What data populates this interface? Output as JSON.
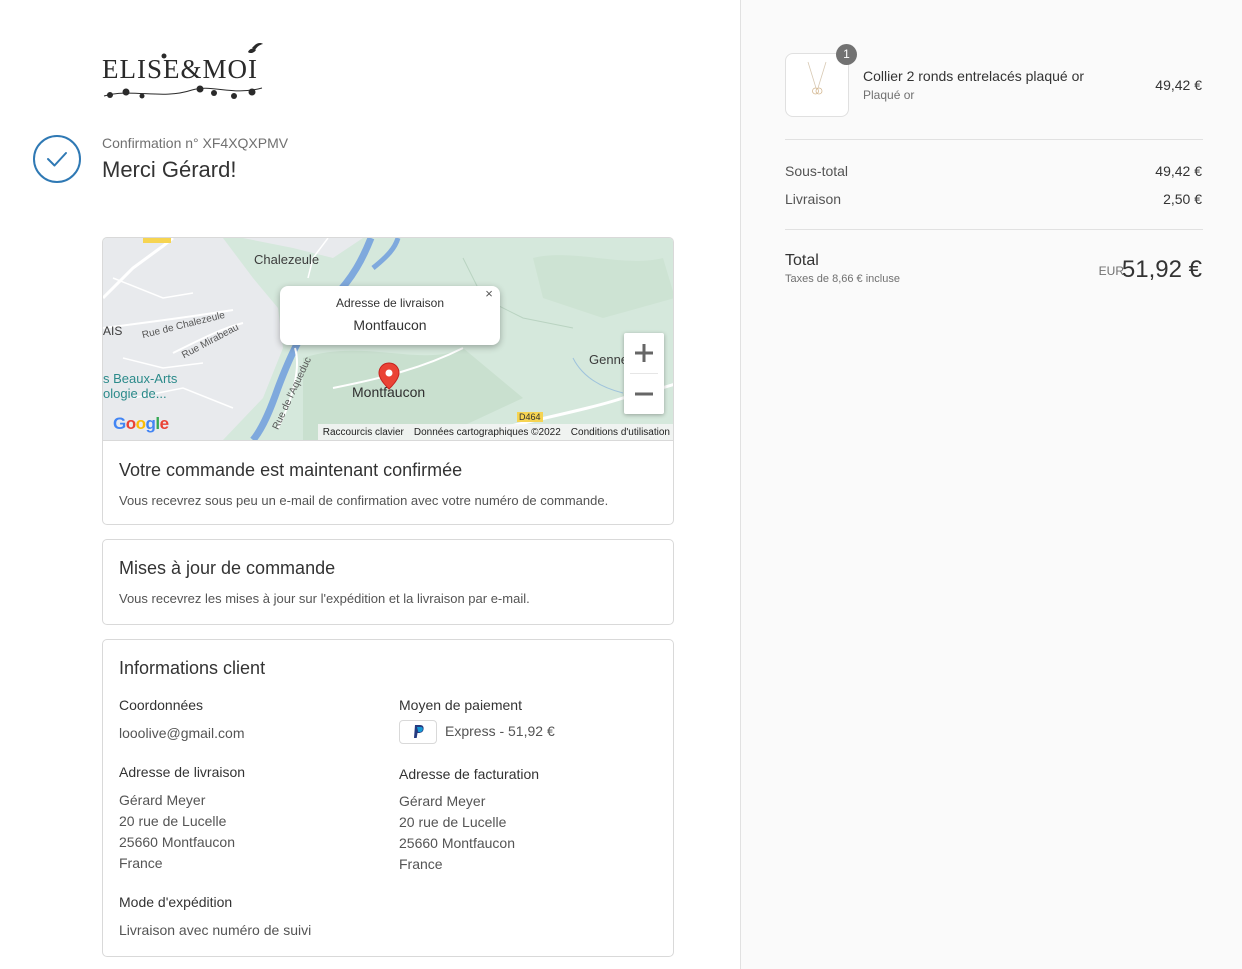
{
  "brand": {
    "logo_text": "ELISE&MOI"
  },
  "confirmation": {
    "number_label": "Confirmation n° XF4XQXPMV",
    "title": "Merci Gérard!"
  },
  "map": {
    "info_window": {
      "title": "Adresse de livraison",
      "value": "Montfaucon",
      "close": "×"
    },
    "labels": {
      "chalezeule": "Chalezeule",
      "rue_chalezeule": "Rue de Chalezeule",
      "rue_mirabeau": "Rue Mirabeau",
      "rue_aqueduc": "Rue de l'Aqueduc",
      "ais": "AIS",
      "beaux_arts_1": "s Beaux-Arts",
      "beaux_arts_2": "ologie de...",
      "genne": "Genne",
      "montfaucon": "Montfaucon",
      "d464": "D464"
    },
    "zoom_in": "+",
    "zoom_out": "−",
    "google": "Google",
    "footer": {
      "shortcuts": "Raccourcis clavier",
      "data": "Données cartographiques ©2022",
      "terms": "Conditions d'utilisation"
    }
  },
  "order_confirmed": {
    "title": "Votre commande est maintenant confirmée",
    "text": "Vous recevrez sous peu un e-mail de confirmation avec votre numéro de commande."
  },
  "order_updates": {
    "title": "Mises à jour de commande",
    "text": "Vous recevrez les mises à jour sur l'expédition et la livraison par e-mail."
  },
  "customer_info": {
    "title": "Informations client",
    "contact_label": "Coordonnées",
    "contact_value": "looolive@gmail.com",
    "payment_label": "Moyen de paiement",
    "payment_value": "Express - 51,92 €",
    "shipping_address_label": "Adresse de livraison",
    "shipping_address": [
      "Gérard Meyer",
      "20 rue de Lucelle",
      "25660 Montfaucon",
      "France"
    ],
    "billing_address_label": "Adresse de facturation",
    "billing_address": [
      "Gérard Meyer",
      "20 rue de Lucelle",
      "25660 Montfaucon",
      "France"
    ],
    "shipping_method_label": "Mode d'expédition",
    "shipping_method_value": "Livraison avec numéro de suivi"
  },
  "summary": {
    "product": {
      "quantity": "1",
      "name": "Collier 2 ronds entrelacés plaqué or",
      "variant": "Plaqué or",
      "price": "49,42 €"
    },
    "subtotal_label": "Sous-total",
    "subtotal_value": "49,42 €",
    "shipping_label": "Livraison",
    "shipping_value": "2,50 €",
    "total_label": "Total",
    "tax_note": "Taxes de 8,66 € incluse",
    "currency": "EUR",
    "total_value": "51,92 €"
  },
  "colors": {
    "accent": "#2f79b4",
    "map_land": "#d5e8dc",
    "map_river": "#7fa9dd",
    "pin": "#ea4335"
  }
}
